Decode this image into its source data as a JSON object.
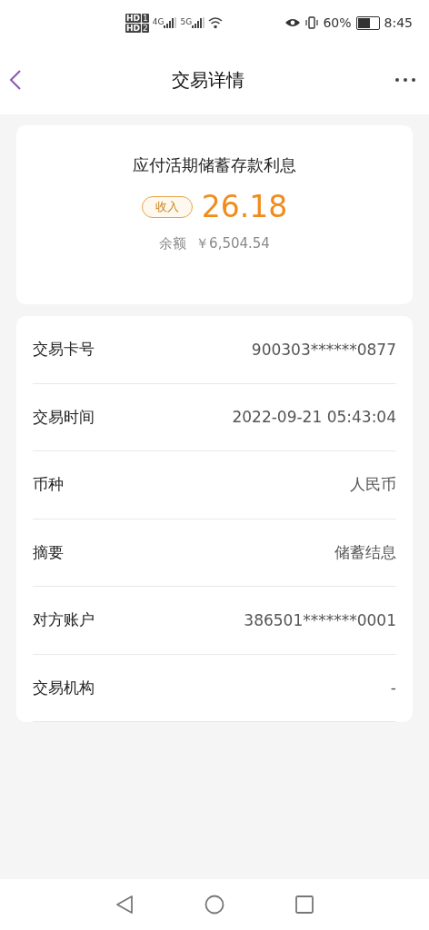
{
  "status_bar": {
    "sims": [
      {
        "label": "HD",
        "slot": "1"
      },
      {
        "label": "HD",
        "slot": "2"
      }
    ],
    "networks": [
      "4G",
      "5G"
    ],
    "battery": "60%",
    "time": "8:45"
  },
  "header": {
    "title": "交易详情"
  },
  "summary": {
    "title": "应付活期储蓄存款利息",
    "tag": "收入",
    "amount": "26.18",
    "balance_label": "余额",
    "balance": "￥6,504.54"
  },
  "details": [
    {
      "label": "交易卡号",
      "value": "900303******0877"
    },
    {
      "label": "交易时间",
      "value": "2022-09-21 05:43:04"
    },
    {
      "label": "币种",
      "value": "人民币"
    },
    {
      "label": "摘要",
      "value": "储蓄结息"
    },
    {
      "label": "对方账户",
      "value": "386501*******0001"
    },
    {
      "label": "交易机构",
      "value": "-"
    }
  ]
}
